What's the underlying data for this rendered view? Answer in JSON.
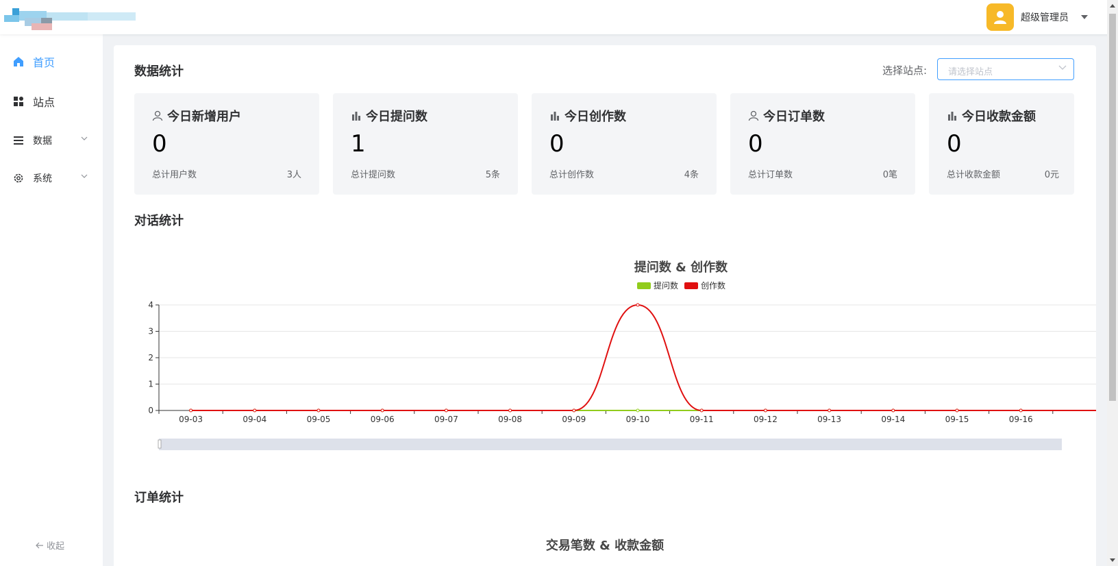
{
  "header": {
    "user_name": "超级管理员",
    "avatar_icon": "user-icon"
  },
  "sidebar": {
    "items": [
      {
        "label": "首页",
        "icon": "home-icon",
        "active": true
      },
      {
        "label": "站点",
        "icon": "grid-icon"
      },
      {
        "label": "数据",
        "icon": "list-icon",
        "expandable": true
      },
      {
        "label": "系统",
        "icon": "gear-icon",
        "expandable": true
      }
    ],
    "collapse_label": "收起"
  },
  "stats": {
    "title": "数据统计",
    "site_select_label": "选择站点:",
    "site_select_placeholder": "请选择站点",
    "cards": [
      {
        "title": "今日新增用户",
        "icon": "user-outline-icon",
        "value": "0",
        "foot_label": "总计用户数",
        "foot_total": "3人"
      },
      {
        "title": "今日提问数",
        "icon": "bar-chart-icon",
        "value": "1",
        "foot_label": "总计提问数",
        "foot_total": "5条"
      },
      {
        "title": "今日创作数",
        "icon": "bar-chart-icon",
        "value": "0",
        "foot_label": "总计创作数",
        "foot_total": "4条"
      },
      {
        "title": "今日订单数",
        "icon": "user-outline-icon",
        "value": "0",
        "foot_label": "总计订单数",
        "foot_total": "0笔"
      },
      {
        "title": "今日收款金额",
        "icon": "bar-chart-icon",
        "value": "0",
        "foot_label": "总计收款金额",
        "foot_total": "0元"
      }
    ]
  },
  "dialog_stats": {
    "title": "对话统计"
  },
  "order_stats": {
    "title": "订单统计",
    "chart_title": "交易笔数 & 收款金额"
  },
  "colors": {
    "accent": "#409eff",
    "series_questions": "#91cc1c",
    "series_creations": "#e01010",
    "avatar_bg": "#f7b928"
  },
  "chart_data": {
    "type": "line",
    "title": "提问数 & 创作数",
    "x": [
      "09-03",
      "09-04",
      "09-05",
      "09-06",
      "09-07",
      "09-08",
      "09-09",
      "09-10",
      "09-11",
      "09-12",
      "09-13",
      "09-14",
      "09-15",
      "09-16"
    ],
    "series": [
      {
        "name": "提问数",
        "values": [
          0,
          0,
          0,
          0,
          0,
          0,
          0,
          0,
          0,
          0,
          0,
          0,
          0,
          0
        ]
      },
      {
        "name": "创作数",
        "values": [
          0,
          0,
          0,
          0,
          0,
          0,
          0,
          4,
          0,
          0,
          0,
          0,
          0,
          0
        ]
      }
    ],
    "yticks": [
      "0",
      "1",
      "2",
      "3",
      "4"
    ],
    "ylim": [
      0,
      4
    ],
    "smooth": true,
    "legend": "top-center",
    "grid": true,
    "data_zoom": true
  }
}
